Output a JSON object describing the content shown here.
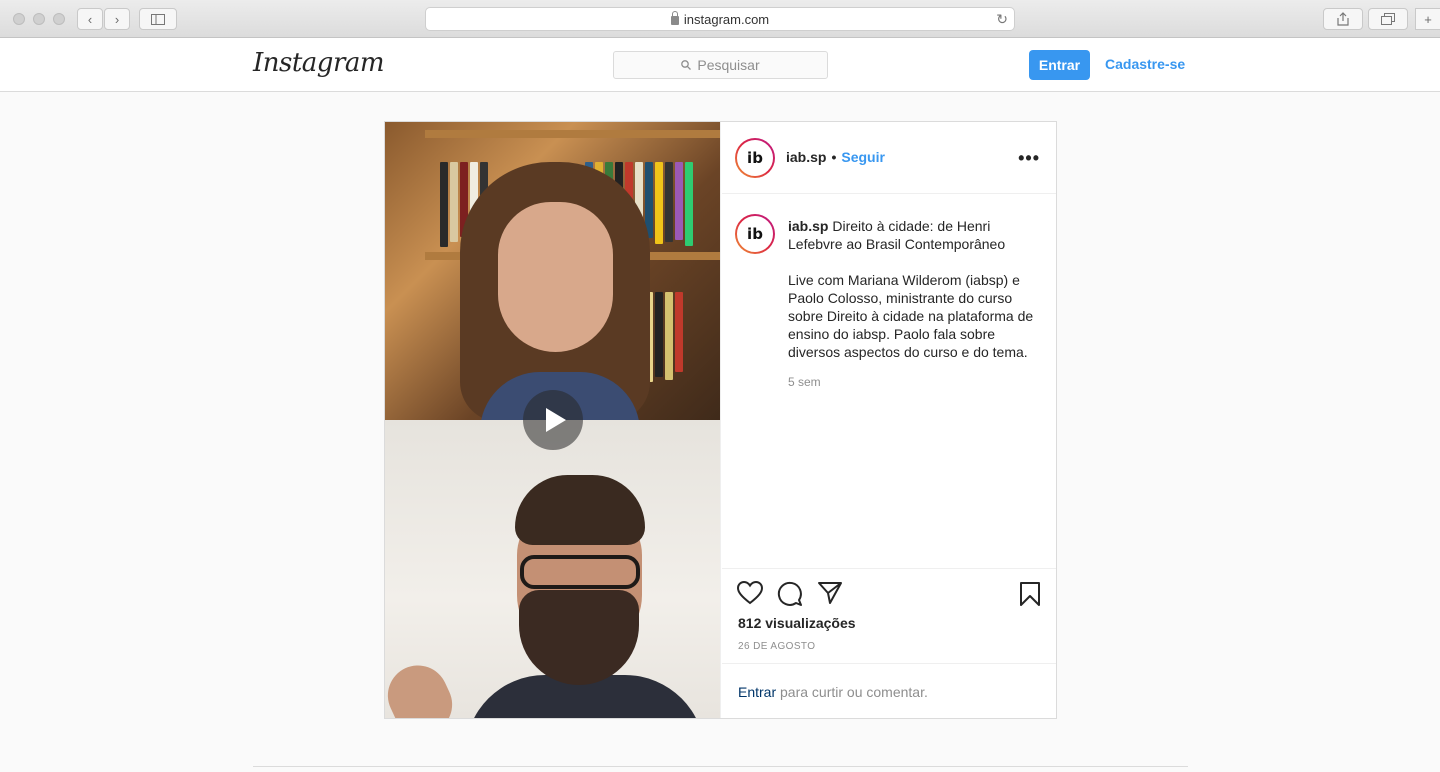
{
  "browser": {
    "url": "instagram.com"
  },
  "header": {
    "logo": "Instagram",
    "search_placeholder": "Pesquisar",
    "login_label": "Entrar",
    "signup_label": "Cadastre-se"
  },
  "post": {
    "username": "iab.sp",
    "follow_separator": "•",
    "follow_label": "Seguir",
    "more_label": "•••",
    "avatar_text": "ib",
    "caption_username": "iab.sp",
    "caption_title": "Direito à cidade: de Henri Lefebvre ao Brasil Contemporâneo",
    "caption_body": "Live com Mariana Wilderom (iabsp) e Paolo Colosso, ministrante do curso sobre Direito à cidade na plataforma de ensino do iabsp. Paolo fala sobre diversos aspectos do curso e do tema.",
    "time_ago": "5 sem",
    "views": "812 visualizações",
    "date": "26 DE AGOSTO",
    "login_link": "Entrar",
    "login_rest": " para curtir ou comentar."
  },
  "icons": {
    "like": "heart-icon",
    "comment": "comment-icon",
    "share": "share-icon",
    "save": "bookmark-icon",
    "play": "play-icon"
  }
}
